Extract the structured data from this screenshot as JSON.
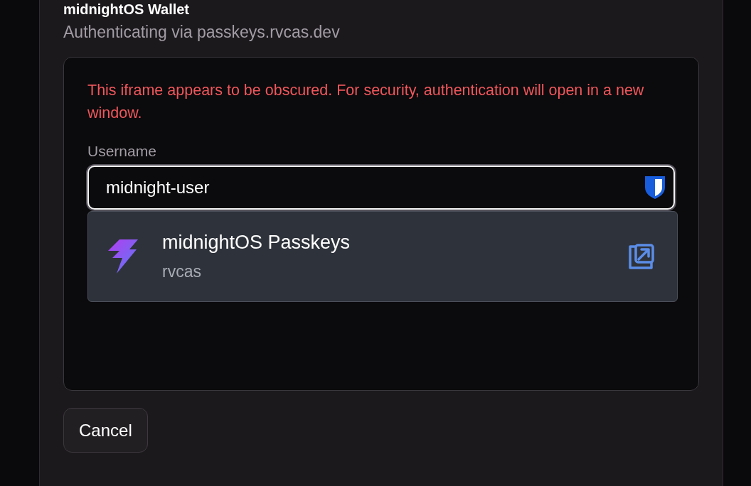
{
  "dialog": {
    "title": "midnightOS Wallet",
    "subtitle": "Authenticating via passkeys.rvcas.dev",
    "warning": "This iframe appears to be obscured. For security, authentication will open in a new window.",
    "username": {
      "label": "Username",
      "value": "midnight-user"
    },
    "autofill": {
      "title": "midnightOS Passkeys",
      "account": "rvcas"
    },
    "buttons": [
      "Cancel"
    ]
  }
}
